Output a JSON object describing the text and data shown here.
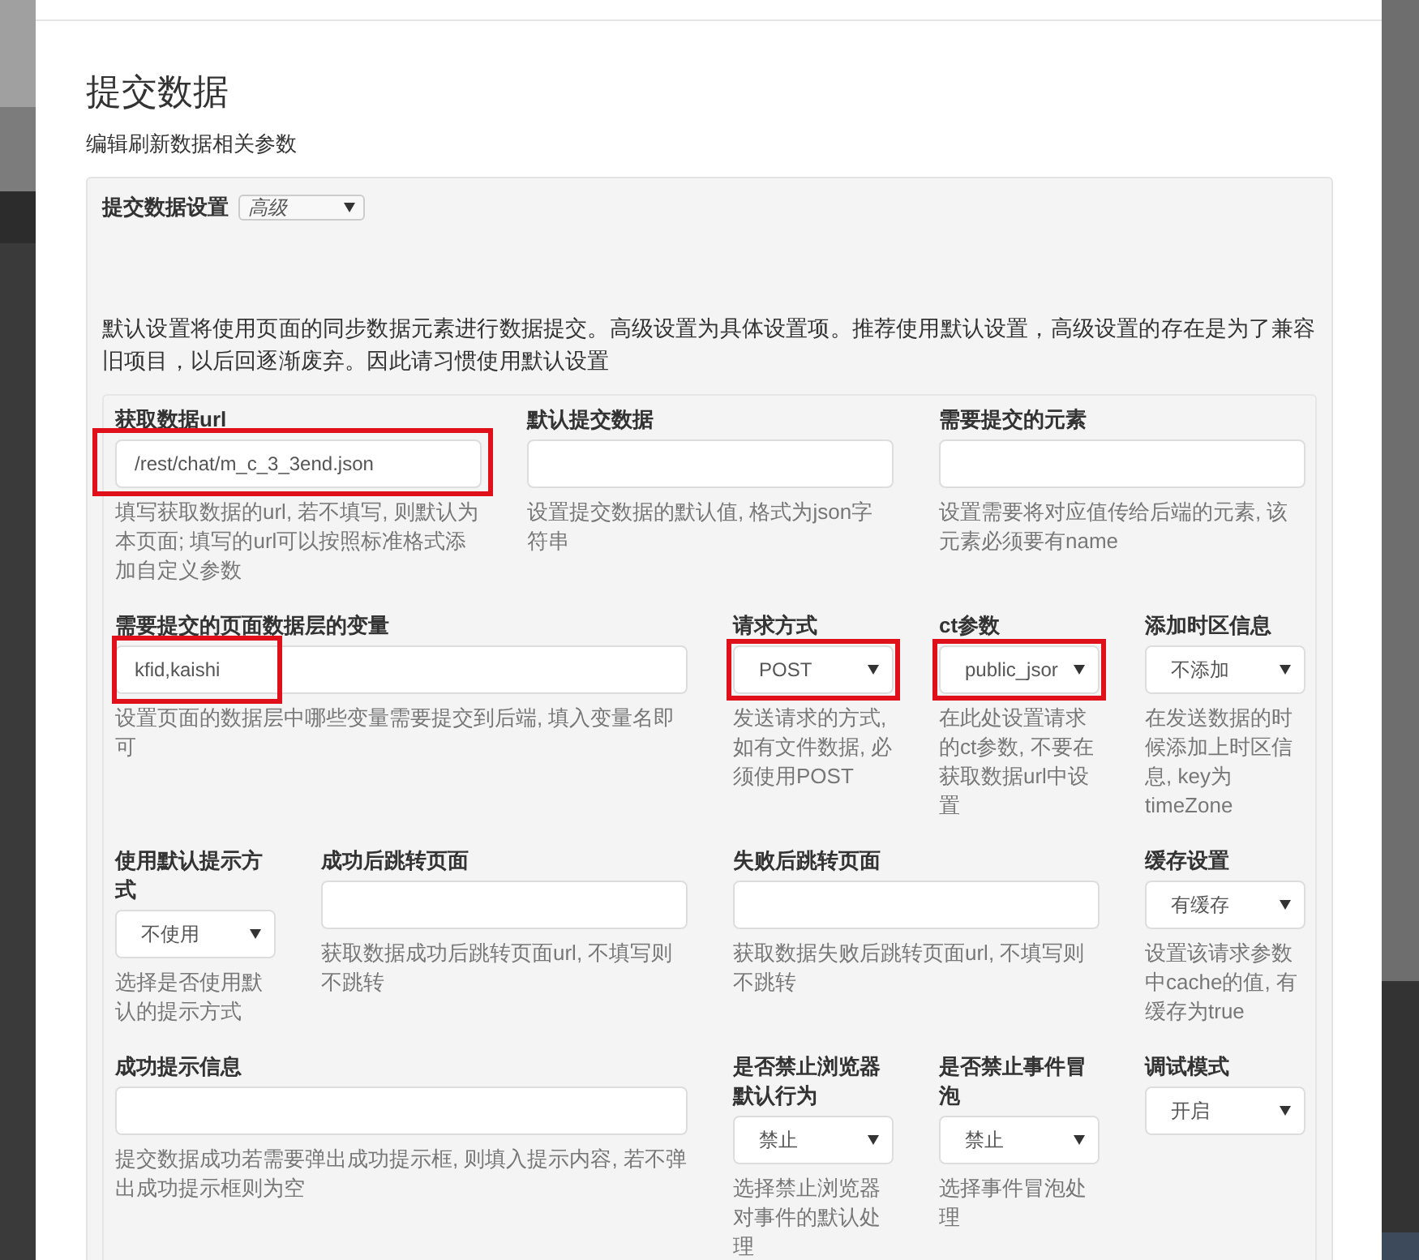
{
  "dialog": {
    "title": "提交数据",
    "subtitle": "编辑刷新数据相关参数"
  },
  "mode": {
    "label": "提交数据设置",
    "value": "高级"
  },
  "description": "默认设置将使用页面的同步数据元素进行数据提交。高级设置为具体设置项。推荐使用默认设置，高级设置的存在是为了兼容旧项目，以后回逐渐废弃。因此请习惯使用默认设置",
  "rows": [
    [
      {
        "kind": "input",
        "label": "获取数据url",
        "value": "/rest/chat/m_c_3_3end.json",
        "highlighted": true,
        "help": "填写获取数据的url, 若不填写, 则默认为本页面; 填写的url可以按照标准格式添加自定义参数"
      },
      {
        "kind": "input",
        "label": "默认提交数据",
        "highlighted": false,
        "help": "设置提交数据的默认值, 格式为json字符串"
      },
      {
        "kind": "input",
        "label": "需要提交的元素",
        "highlighted": false,
        "help": "设置需要将对应值传给后端的元素, 该元素必须要有name"
      }
    ],
    [
      {
        "kind": "input",
        "label": "需要提交的页面数据层的变量",
        "value": "kfid,kaishi",
        "highlighted": true,
        "help": "设置页面的数据层中哪些变量需要提交到后端, 填入变量名即可"
      },
      {
        "kind": "select",
        "label": "请求方式",
        "value": "POST",
        "highlighted": true,
        "help": "发送请求的方式, 如有文件数据, 必须使用POST"
      },
      {
        "kind": "select",
        "label": "ct参数",
        "value": "public_jsor",
        "highlighted": true,
        "help": "在此处设置请求的ct参数, 不要在获取数据url中设置"
      },
      {
        "kind": "select",
        "label": "添加时区信息",
        "value": "不添加",
        "highlighted": false,
        "help": "在发送数据的时候添加上时区信息, key为timeZone"
      }
    ],
    [
      {
        "kind": "select",
        "label": "使用默认提示方式",
        "value": "不使用",
        "highlighted": false,
        "help": "选择是否使用默认的提示方式"
      },
      {
        "kind": "input",
        "label": "成功后跳转页面",
        "highlighted": false,
        "help": "获取数据成功后跳转页面url, 不填写则不跳转"
      },
      {
        "kind": "input",
        "label": "失败后跳转页面",
        "highlighted": false,
        "help": "获取数据失败后跳转页面url, 不填写则不跳转"
      },
      {
        "kind": "select",
        "label": "缓存设置",
        "value": "有缓存",
        "highlighted": false,
        "help": "设置该请求参数中cache的值, 有缓存为true"
      }
    ],
    [
      {
        "kind": "input",
        "label": "成功提示信息",
        "highlighted": false,
        "help": "提交数据成功若需要弹出成功提示框, 则填入提示内容, 若不弹出成功提示框则为空"
      },
      {
        "kind": "select",
        "label": "是否禁止浏览器默认行为",
        "value": "禁止",
        "highlighted": false,
        "help": "选择禁止浏览器对事件的默认处理"
      },
      {
        "kind": "select",
        "label": "是否禁止事件冒泡",
        "value": "禁止",
        "highlighted": false,
        "help": "选择事件冒泡处理"
      },
      {
        "kind": "select",
        "label": "调试模式",
        "value": "开启",
        "highlighted": false
      }
    ]
  ]
}
